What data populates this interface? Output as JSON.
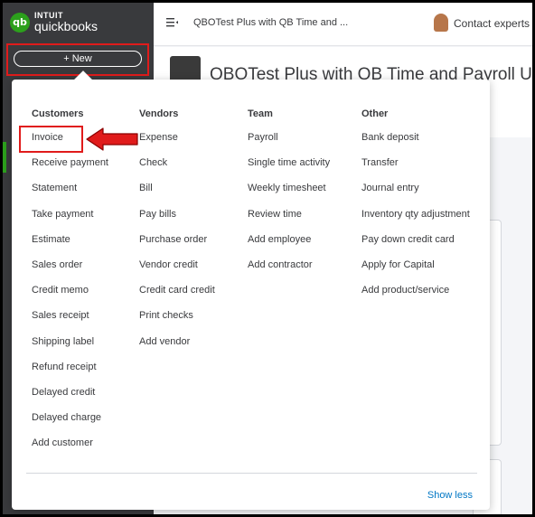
{
  "brand": {
    "line1": "INTUIT",
    "line2": "quickbooks",
    "logo_glyph": "qb"
  },
  "sidebar": {
    "new_label": "+ New"
  },
  "topbar": {
    "company_short": "QBOTest Plus with QB Time and ...",
    "contact_label": "Contact experts",
    "menu_icon": "hamburger-icon"
  },
  "page": {
    "title": "QBOTest Plus with QB Time and Payroll US"
  },
  "menu": {
    "columns": [
      {
        "header": "Customers",
        "items": [
          "Invoice",
          "Receive payment",
          "Statement",
          "Take payment",
          "Estimate",
          "Sales order",
          "Credit memo",
          "Sales receipt",
          "Shipping label",
          "Refund receipt",
          "Delayed credit",
          "Delayed charge",
          "Add customer"
        ]
      },
      {
        "header": "Vendors",
        "items": [
          "Expense",
          "Check",
          "Bill",
          "Pay bills",
          "Purchase order",
          "Vendor credit",
          "Credit card credit",
          "Print checks",
          "Add vendor"
        ]
      },
      {
        "header": "Team",
        "items": [
          "Payroll",
          "Single time activity",
          "Weekly timesheet",
          "Review time",
          "Add employee",
          "Add contractor"
        ]
      },
      {
        "header": "Other",
        "items": [
          "Bank deposit",
          "Transfer",
          "Journal entry",
          "Inventory qty adjustment",
          "Pay down credit card",
          "Apply for Capital",
          "Add product/service"
        ]
      }
    ],
    "show_less": "Show less"
  },
  "colors": {
    "brand_green": "#2ca01c",
    "annotation_red": "#e01b1b",
    "link_blue": "#0077c5",
    "sidebar": "#393a3d"
  }
}
